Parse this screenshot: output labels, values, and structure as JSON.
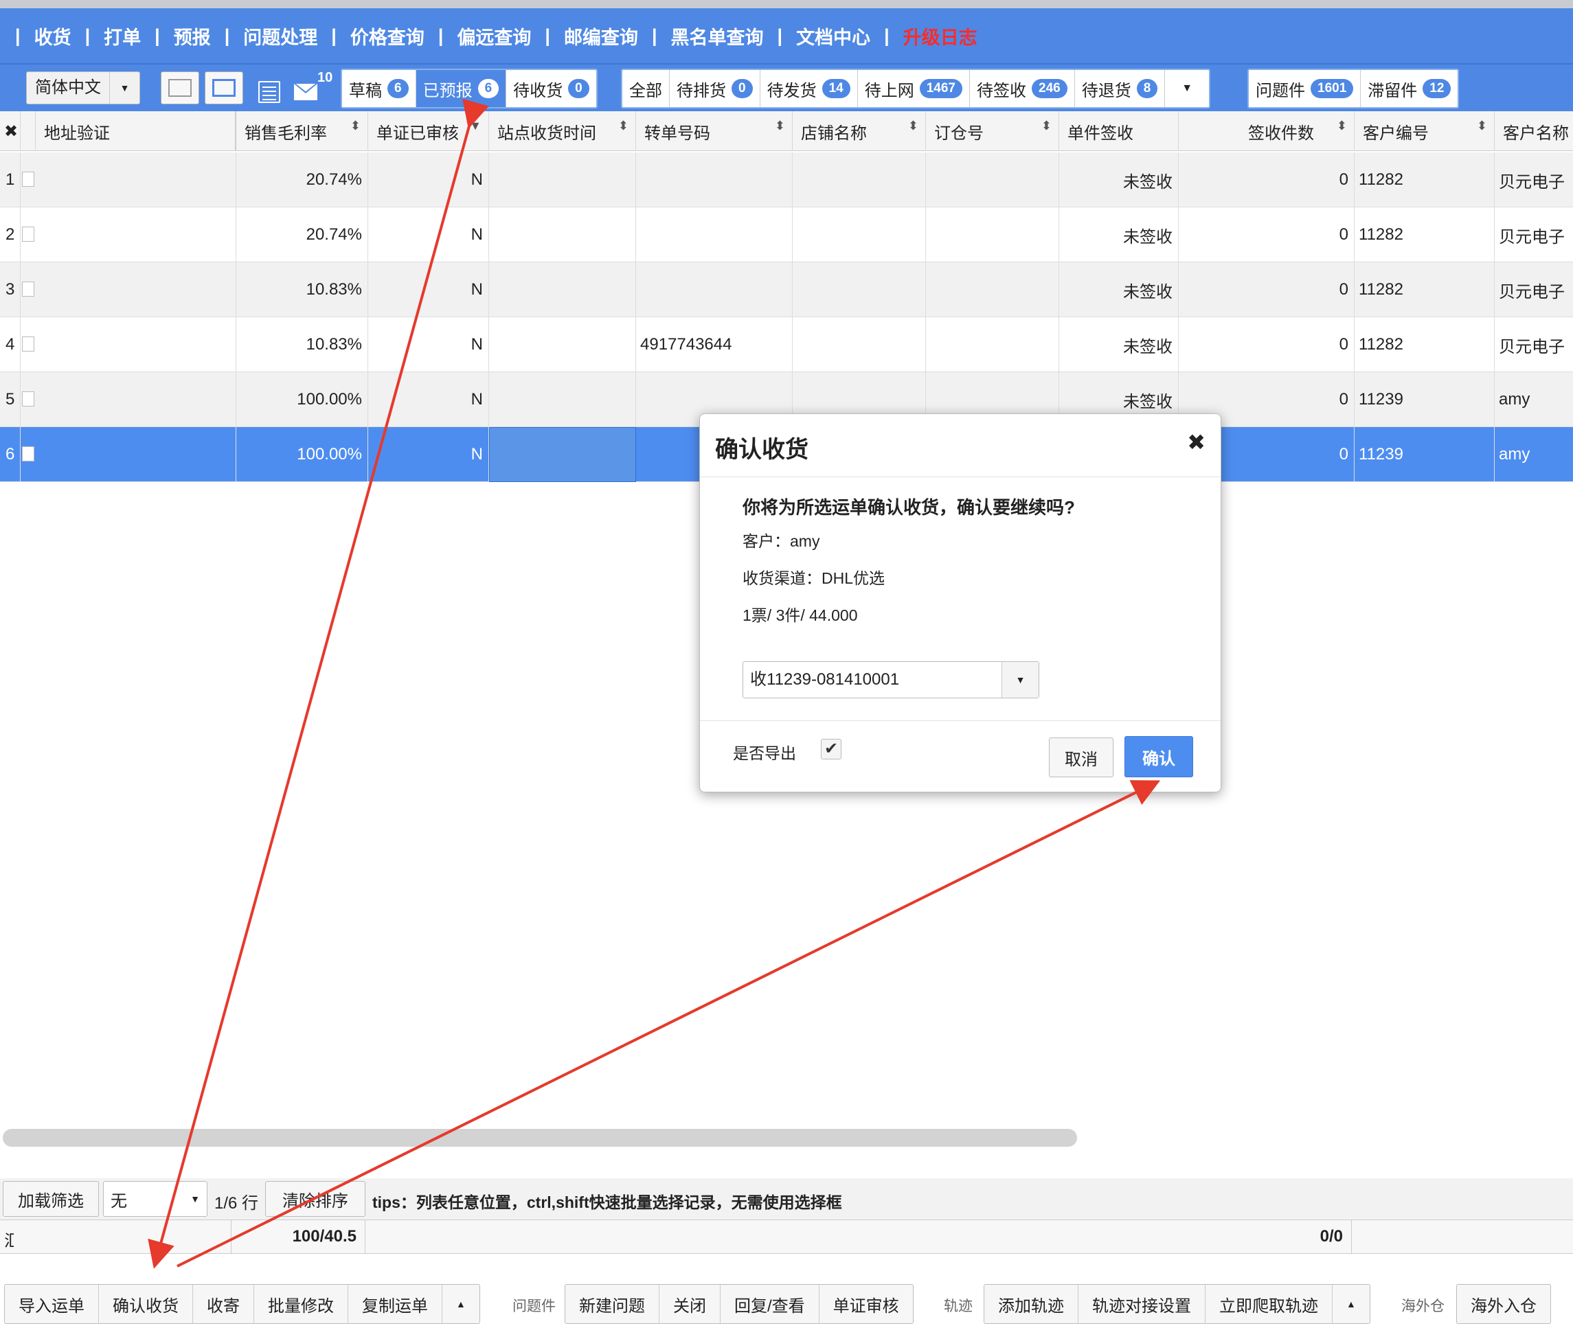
{
  "nav": {
    "items": [
      "收货",
      "打单",
      "预报",
      "问题处理",
      "价格查询",
      "偏远查询",
      "邮编查询",
      "黑名单查询",
      "文档中心",
      "升级日志"
    ],
    "separator": "|",
    "highlight_index": 9
  },
  "toolbar": {
    "language": "简体中文",
    "mail_count": "10",
    "tab_group_1": [
      {
        "label": "草稿",
        "count": "6",
        "active": false
      },
      {
        "label": "已预报",
        "count": "6",
        "active": true
      },
      {
        "label": "待收货",
        "count": "0",
        "active": false
      }
    ],
    "tab_group_2": [
      {
        "label": "全部",
        "count": ""
      },
      {
        "label": "待排货",
        "count": "0"
      },
      {
        "label": "待发货",
        "count": "14"
      },
      {
        "label": "待上网",
        "count": "1467"
      },
      {
        "label": "待签收",
        "count": "246"
      },
      {
        "label": "待退货",
        "count": "8"
      }
    ],
    "tab_group_3": [
      {
        "label": "问题件",
        "count": "1601"
      },
      {
        "label": "滞留件",
        "count": "12"
      }
    ]
  },
  "grid": {
    "columns": [
      "地址验证",
      "销售毛利率",
      "单证已审核",
      "站点收货时间",
      "转单号码",
      "店铺名称",
      "订仓号",
      "单件签收",
      "签收件数",
      "客户编号",
      "客户名称"
    ],
    "column_display": [
      "地址验证",
      "销售毛利率",
      "单证已审核",
      "站点收货时间",
      "转单号码",
      "店铺名称",
      "订仓号",
      "单件签收",
      "签收件数",
      "客户编号",
      "客户名称"
    ],
    "rows": [
      {
        "n": "1",
        "addr": "",
        "margin": "20.74%",
        "audited": "N",
        "time": "",
        "transfer": "",
        "shop": "",
        "booking": "",
        "sign": "未签收",
        "count": "0",
        "cust_no": "11282",
        "cust_name": "贝元电子"
      },
      {
        "n": "2",
        "addr": "",
        "margin": "20.74%",
        "audited": "N",
        "time": "",
        "transfer": "",
        "shop": "",
        "booking": "",
        "sign": "未签收",
        "count": "0",
        "cust_no": "11282",
        "cust_name": "贝元电子"
      },
      {
        "n": "3",
        "addr": "",
        "margin": "10.83%",
        "audited": "N",
        "time": "",
        "transfer": "",
        "shop": "",
        "booking": "",
        "sign": "未签收",
        "count": "0",
        "cust_no": "11282",
        "cust_name": "贝元电子"
      },
      {
        "n": "4",
        "addr": "",
        "margin": "10.83%",
        "audited": "N",
        "time": "",
        "transfer": "4917743644",
        "shop": "",
        "booking": "",
        "sign": "未签收",
        "count": "0",
        "cust_no": "11282",
        "cust_name": "贝元电子"
      },
      {
        "n": "5",
        "addr": "",
        "margin": "100.00%",
        "audited": "N",
        "time": "",
        "transfer": "",
        "shop": "",
        "booking": "",
        "sign": "未签收",
        "count": "0",
        "cust_no": "11239",
        "cust_name": "amy"
      },
      {
        "n": "6",
        "addr": "",
        "margin": "100.00%",
        "audited": "N",
        "time": "",
        "transfer": "",
        "shop": "",
        "booking": "",
        "sign": "",
        "count": "0",
        "cust_no": "11239",
        "cust_name": "amy"
      }
    ],
    "selected_row": 6
  },
  "footer": {
    "load_filter": "加载筛选",
    "filter_value": "无",
    "row_info": "1/6 行",
    "clear_sort": "清除排序",
    "tips": "tips：列表任意位置，ctrl,shift快速批量选择记录，无需使用选择框",
    "sum_label": "汇",
    "sum_margin": "100/40.5",
    "sum_count": "0/0"
  },
  "modal": {
    "title": "确认收货",
    "close_glyph": "✖",
    "question": "你将为所选运单确认收货，确认要继续吗?",
    "customer": "客户：amy",
    "channel": "收货渠道：DHL优选",
    "summary": "1票/ 3件/ 44.000",
    "select_value": "收11239-081410001",
    "export_label": "是否导出",
    "export_checked": true,
    "cancel": "取消",
    "confirm": "确认"
  },
  "bottom": {
    "group1": [
      "导入运单",
      "确认收货",
      "收寄",
      "批量修改",
      "复制运单"
    ],
    "problem_label": "问题件",
    "group2": [
      "新建问题",
      "关闭",
      "回复/查看",
      "单证审核"
    ],
    "track_label": "轨迹",
    "group3": [
      "添加轨迹",
      "轨迹对接设置",
      "立即爬取轨迹"
    ],
    "overseas_label": "海外仓",
    "group4": [
      "海外入仓"
    ]
  },
  "colors": {
    "nav_blue": "#4e88e4",
    "selected_row": "#4e8df0",
    "confirm": "#4e8df0",
    "arrow": "#e53a2c",
    "upgrade_log": "#ff2a2a"
  }
}
